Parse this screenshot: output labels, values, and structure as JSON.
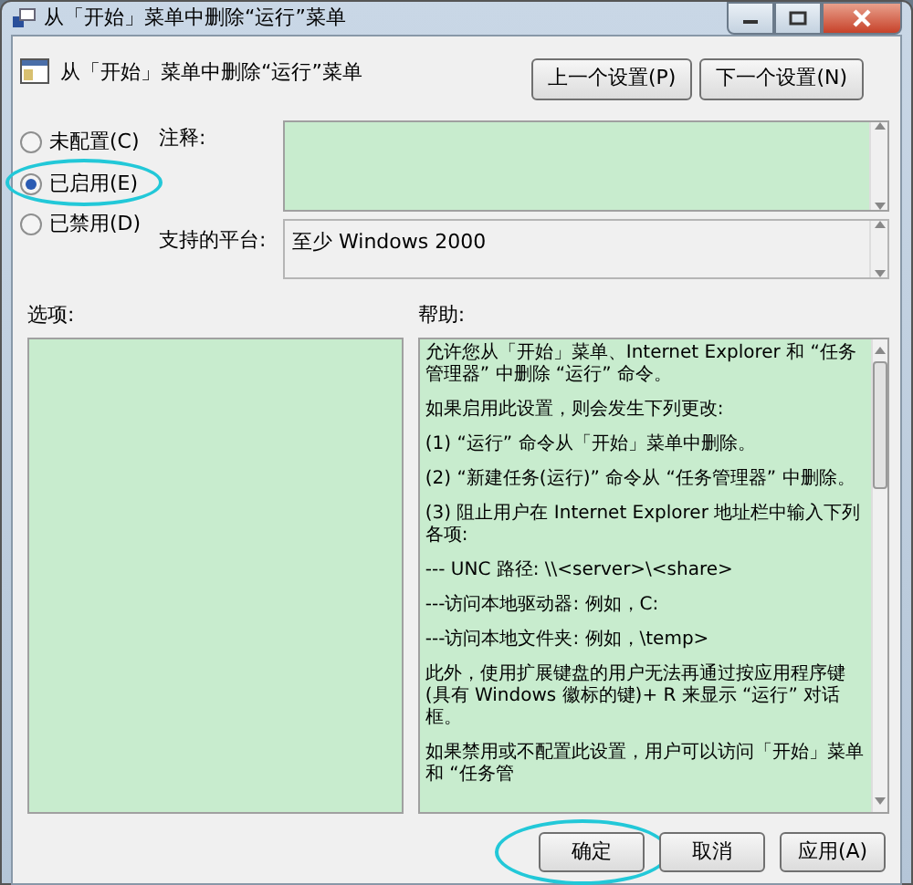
{
  "window": {
    "title": "从「开始」菜单中删除“运行”菜单"
  },
  "header": {
    "title": "从「开始」菜单中删除“运行”菜单",
    "buttons": [
      {
        "label": "上一个设置(P)"
      },
      {
        "label": "下一个设置(N)"
      }
    ]
  },
  "radios": [
    {
      "label": "未配置(C)",
      "selected": false,
      "highlighted": false
    },
    {
      "label": "已启用(E)",
      "selected": true,
      "highlighted": true
    },
    {
      "label": "已禁用(D)",
      "selected": false,
      "highlighted": false
    }
  ],
  "comment": {
    "label": "注释:"
  },
  "platform": {
    "label": "支持的平台:",
    "value": "至少 Windows 2000"
  },
  "options": {
    "label": "选项:"
  },
  "help": {
    "label": "帮助:",
    "paragraphs": [
      "允许您从「开始」菜单、Internet Explorer 和 “任务管理器” 中删除 “运行” 命令。",
      "如果启用此设置，则会发生下列更改:",
      "(1) “运行” 命令从「开始」菜单中删除。",
      "(2) “新建任务(运行)” 命令从 “任务管理器” 中删除。",
      "(3) 阻止用户在 Internet Explorer 地址栏中输入下列各项:",
      "--- UNC 路径: \\\\<server>\\<share>",
      "---访问本地驱动器: 例如，C:",
      "---访问本地文件夹: 例如，\\temp>",
      "此外，使用扩展键盘的用户无法再通过按应用程序键(具有 Windows 徽标的键)+ R 来显示 “运行” 对话框。",
      "如果禁用或不配置此设置，用户可以访问「开始」菜单和 “任务管"
    ]
  },
  "buttons": [
    {
      "label": "确定",
      "highlighted": true
    },
    {
      "label": "取消",
      "highlighted": false
    },
    {
      "label": "应用(A)",
      "highlighted": false
    }
  ]
}
